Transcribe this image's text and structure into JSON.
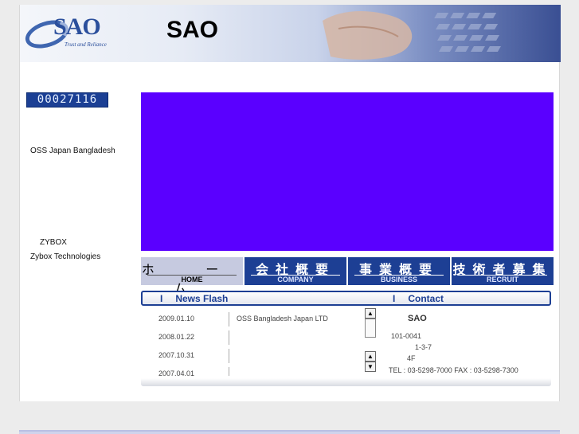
{
  "header": {
    "logo_word": "SAO",
    "logo_tagline": "Trust and Reliance",
    "title": "SAO"
  },
  "counter": "00027116",
  "sidebar": {
    "links": [
      "OSS Japan Bangladesh",
      "ZYBOX",
      "Zybox Technologies"
    ]
  },
  "nav": [
    {
      "jp": "ホ ー ム",
      "en": "HOME",
      "active": true
    },
    {
      "jp": "会社概要",
      "en": "COMPANY"
    },
    {
      "jp": "事業概要",
      "en": "BUSINESS"
    },
    {
      "jp": "技術者募集",
      "en": "RECRUIT"
    }
  ],
  "bar": {
    "news_label": "News Flash",
    "contact_label": "Contact"
  },
  "news": [
    {
      "date": "2009.01.10",
      "text": "OSS Bangladesh Japan LTD"
    },
    {
      "date": "2008.01.22",
      "text": ""
    },
    {
      "date": "2007.10.31",
      "text": ""
    },
    {
      "date": "2007.04.01",
      "text": ""
    }
  ],
  "contact": {
    "name": "SAO",
    "postal": "101-0041",
    "address": "1-3-7",
    "floor": "4F",
    "phone": "TEL : 03-5298-7000 FAX : 03-5298-7300"
  }
}
